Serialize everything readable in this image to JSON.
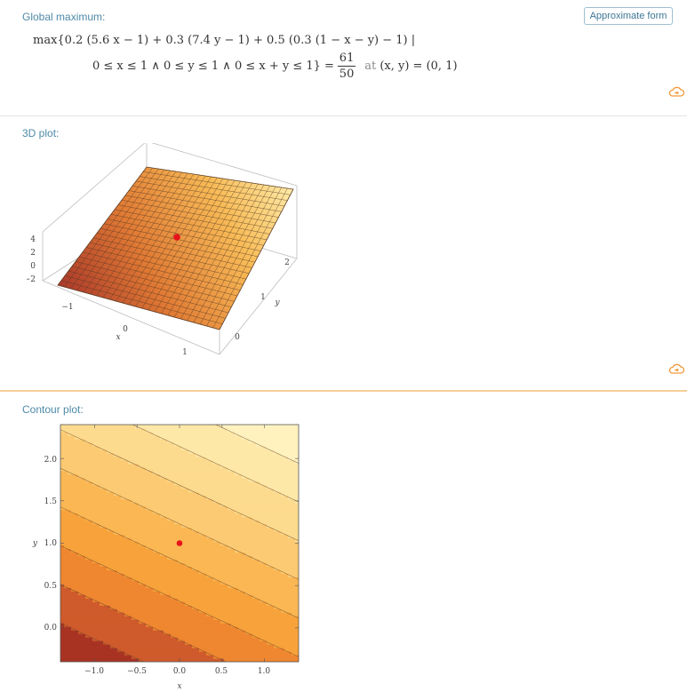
{
  "pods": {
    "global_max": {
      "title": "Global maximum:",
      "approx_button": "Approximate form",
      "line1": "max{0.2 (5.6 x − 1) + 0.3 (7.4 y − 1) + 0.5 (0.3 (1 − x − y) − 1) |",
      "line2": "0 ≤ x ≤ 1 ∧ 0 ≤ y ≤ 1 ∧ 0 ≤ x + y ≤ 1} =",
      "frac_num": "61",
      "frac_den": "50",
      "at_text": "at",
      "point_text": "(x, y) = (0, 1)"
    },
    "plot3d": {
      "title": "3D plot:",
      "z_ticks": [
        "4",
        "2",
        "0",
        "−2"
      ],
      "x_ticks": [
        "−1",
        "0",
        "1"
      ],
      "y_ticks": [
        "0",
        "1",
        "2"
      ],
      "x_label": "x",
      "y_label": "y"
    },
    "contour": {
      "title": "Contour plot:",
      "y_ticks": [
        "2.0",
        "1.5",
        "1.0",
        "0.5",
        "0.0"
      ],
      "x_ticks": [
        "−1.0",
        "−0.5",
        "0.0",
        "0.5",
        "1.0"
      ],
      "x_label": "x",
      "y_label": "y"
    }
  },
  "chart_data": [
    {
      "type": "surface3d",
      "function": "0.2 (5.6 x − 1) + 0.3 (7.4 y − 1) + 0.5 (0.3 (1 − x − y) − 1)",
      "xlim": [
        -1.4,
        1.4
      ],
      "ylim": [
        -0.4,
        2.4
      ],
      "maximum_point": {
        "x": 0,
        "y": 1
      },
      "colors": {
        "low": "#b0392b",
        "high": "#fff1b8",
        "point": "#e8121a"
      }
    },
    {
      "type": "contour",
      "function": "0.2 (5.6 x − 1) + 0.3 (7.4 y − 1) + 0.5 (0.3 (1 − x − y) − 1)",
      "xlim": [
        -1.4,
        1.4
      ],
      "ylim": [
        -0.4,
        2.4
      ],
      "x_ticks": [
        -1.0,
        -0.5,
        0.0,
        0.5,
        1.0
      ],
      "y_ticks": [
        0.0,
        0.5,
        1.0,
        1.5,
        2.0
      ],
      "maximum_point": {
        "x": 0,
        "y": 1
      },
      "band_colors": [
        "#a83323",
        "#cf5a2b",
        "#ef8630",
        "#f7a23a",
        "#fab753",
        "#fcca72",
        "#fddb8e",
        "#fee8a8",
        "#fff2bf"
      ]
    }
  ]
}
